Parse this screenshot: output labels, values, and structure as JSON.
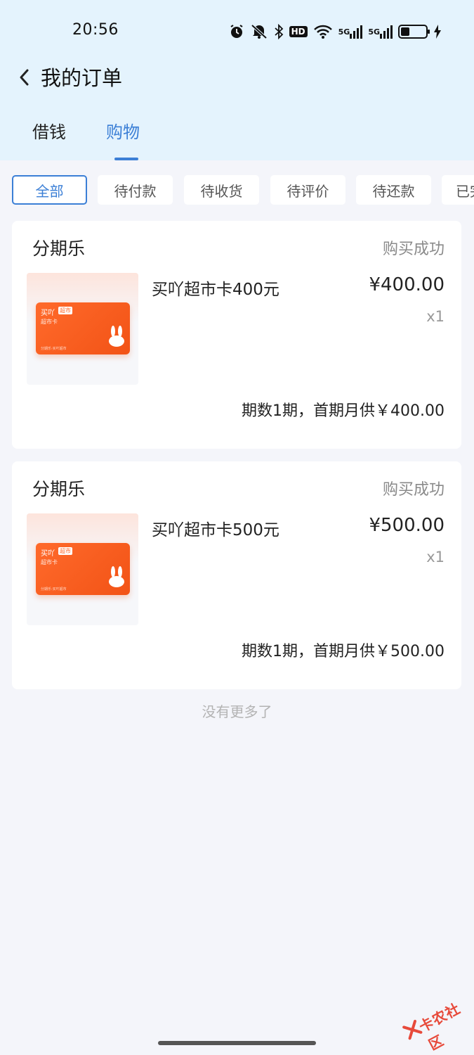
{
  "status_bar": {
    "time": "20:56",
    "icons": [
      "alarm-icon",
      "mute-icon",
      "bluetooth-icon",
      "hd-icon",
      "wifi-icon",
      "signal-5g-icon",
      "signal-5g-icon",
      "battery-icon",
      "charging-icon"
    ],
    "hd_label": "HD",
    "g5_label_1": "5G",
    "g5_label_2": "5G",
    "battery_level": 0.35
  },
  "header": {
    "title": "我的订单",
    "back_icon": "chevron-left-icon"
  },
  "tabs": [
    {
      "label": "借钱",
      "active": false
    },
    {
      "label": "购物",
      "active": true
    }
  ],
  "filters": [
    {
      "label": "全部",
      "active": true
    },
    {
      "label": "待付款",
      "active": false
    },
    {
      "label": "待收货",
      "active": false
    },
    {
      "label": "待评价",
      "active": false
    },
    {
      "label": "待还款",
      "active": false
    },
    {
      "label": "已完",
      "active": false
    }
  ],
  "orders": [
    {
      "shop": "分期乐",
      "status": "购买成功",
      "product_name": "买吖超市卡400元",
      "price": "¥400.00",
      "quantity": "x1",
      "plan": "期数1期，首期月供￥400.00",
      "card_brand": "买吖",
      "card_badge": "超市",
      "card_sub": "超市卡",
      "card_fine": "分期乐·买吖超市"
    },
    {
      "shop": "分期乐",
      "status": "购买成功",
      "product_name": "买吖超市卡500元",
      "price": "¥500.00",
      "quantity": "x1",
      "plan": "期数1期，首期月供￥500.00",
      "card_brand": "买吖",
      "card_badge": "超市",
      "card_sub": "超市卡",
      "card_fine": "分期乐·买吖超市"
    }
  ],
  "footer": {
    "no_more": "没有更多了"
  },
  "watermark": {
    "text": "卡农社区"
  },
  "colors": {
    "accent": "#3b7fd6",
    "header_bg": "#e4f3fd",
    "page_bg": "#f4f5fa",
    "card_orange": "#ff6a2b"
  }
}
